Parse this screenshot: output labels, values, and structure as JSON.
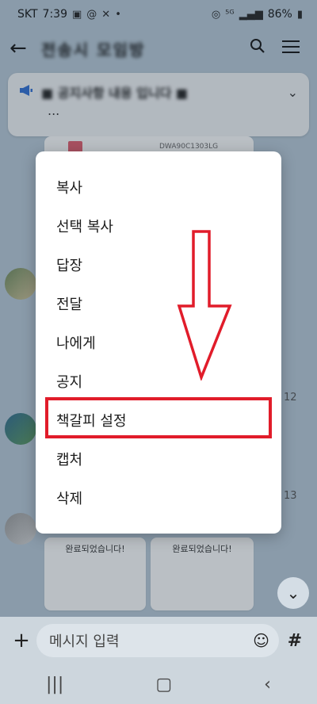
{
  "status_bar": {
    "carrier": "SKT",
    "time": "7:39",
    "battery": "86%",
    "icons": [
      "gallery-icon",
      "threads-icon",
      "x-icon",
      "dot-icon",
      "hotspot-icon",
      "5g-icon",
      "signal-icon",
      "battery-icon"
    ]
  },
  "header": {
    "title": "전송시 모임방",
    "icons": [
      "back-arrow-icon",
      "search-icon",
      "menu-icon"
    ]
  },
  "notice": {
    "text": "■ 공지사항 내용 입니다 ■",
    "more": "..."
  },
  "chat": {
    "card_code": "DWA90C1303LG",
    "time_1": "12",
    "time_2": "13",
    "bottom_card_1_title": "완료되었습니다!",
    "bottom_card_2_title": "완료되었습니다!"
  },
  "context_menu": {
    "items": [
      {
        "label": "복사"
      },
      {
        "label": "선택 복사"
      },
      {
        "label": "답장"
      },
      {
        "label": "전달"
      },
      {
        "label": "나에게"
      },
      {
        "label": "공지"
      },
      {
        "label": "책갈피 설정"
      },
      {
        "label": "캡처"
      },
      {
        "label": "삭제"
      }
    ],
    "highlighted_index": 6
  },
  "input_bar": {
    "placeholder": "메시지 입력"
  },
  "colors": {
    "highlight_red": "#e11c2a",
    "accent_blue": "#2f6fd6"
  }
}
